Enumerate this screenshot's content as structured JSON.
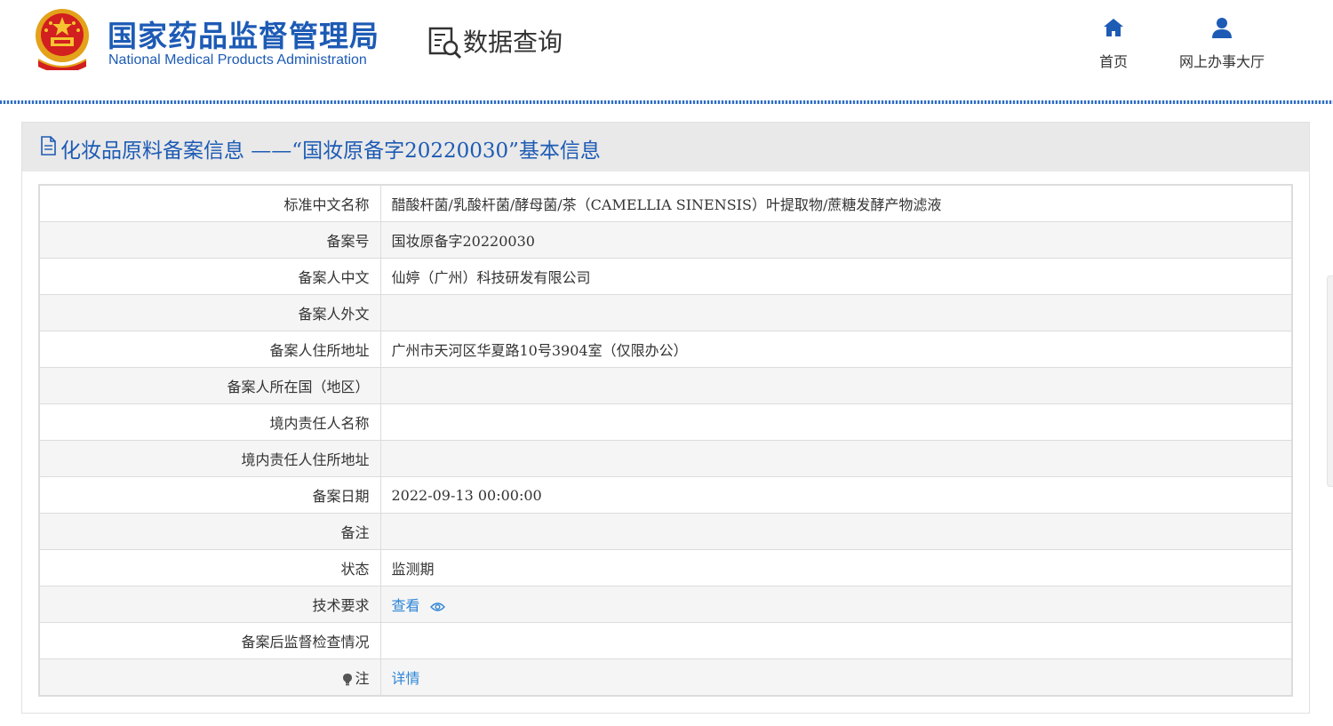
{
  "header": {
    "site_name_cn": "国家药品监督管理局",
    "site_name_en": "National Medical Products Administration",
    "query_title": "数据查询",
    "brand_color": "#1d5bb5",
    "nav": [
      {
        "label": "首页",
        "icon": "home-icon"
      },
      {
        "label": "网上办事大厅",
        "icon": "user-icon"
      }
    ]
  },
  "panel": {
    "title": "化妆品原料备案信息 ——“国妆原备字20220030”基本信息",
    "title_icon": "document-icon",
    "rows": [
      {
        "label": "标准中文名称",
        "value": "醋酸杆菌/乳酸杆菌/酵母菌/茶（CAMELLIA SINENSIS）叶提取物/蔗糖发酵产物滤液"
      },
      {
        "label": "备案号",
        "value": "国妆原备字20220030"
      },
      {
        "label": "备案人中文",
        "value": "仙婷（广州）科技研发有限公司"
      },
      {
        "label": "备案人外文",
        "value": ""
      },
      {
        "label": "备案人住所地址",
        "value": "广州市天河区华夏路10号3904室（仅限办公）"
      },
      {
        "label": "备案人所在国（地区）",
        "value": ""
      },
      {
        "label": "境内责任人名称",
        "value": ""
      },
      {
        "label": "境内责任人住所地址",
        "value": ""
      },
      {
        "label": "备案日期",
        "value": "2022-09-13 00:00:00"
      },
      {
        "label": "备注",
        "value": ""
      },
      {
        "label": "状态",
        "value": "监测期"
      },
      {
        "label": "技术要求",
        "value": "查看",
        "icon": "eye-icon",
        "link_color": "#2f86d6"
      },
      {
        "label": "备案后监督检查情况",
        "value": ""
      },
      {
        "label": "注",
        "value": "详情",
        "label_icon": "bulb-icon",
        "link_color": "#2f86d6"
      }
    ]
  }
}
